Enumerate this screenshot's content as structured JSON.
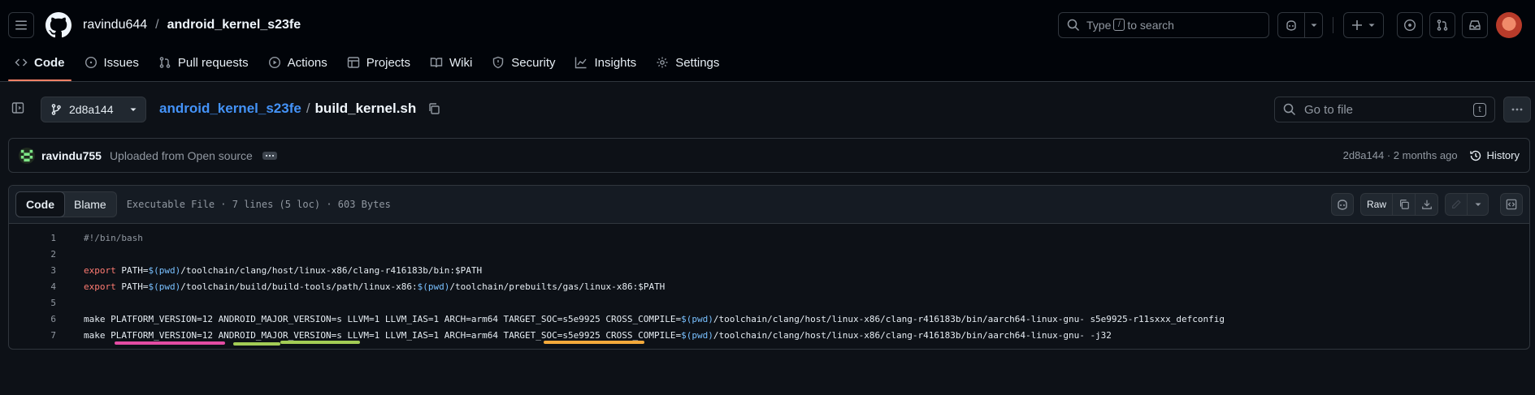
{
  "header": {
    "owner": "ravindu644",
    "separator": "/",
    "repo": "android_kernel_s23fe",
    "search": {
      "prefix": "Type",
      "key": "/",
      "suffix": "to search"
    }
  },
  "nav": {
    "tabs": [
      {
        "label": "Code",
        "icon": "code-icon",
        "active": true
      },
      {
        "label": "Issues",
        "icon": "issue-opened-icon"
      },
      {
        "label": "Pull requests",
        "icon": "git-pull-request-icon"
      },
      {
        "label": "Actions",
        "icon": "play-icon"
      },
      {
        "label": "Projects",
        "icon": "table-icon"
      },
      {
        "label": "Wiki",
        "icon": "book-icon"
      },
      {
        "label": "Security",
        "icon": "shield-icon"
      },
      {
        "label": "Insights",
        "icon": "graph-icon"
      },
      {
        "label": "Settings",
        "icon": "gear-icon"
      }
    ]
  },
  "filenav": {
    "branch": "2d8a144",
    "repo_link": "android_kernel_s23fe",
    "separator": "/",
    "filename": "build_kernel.sh",
    "goto_placeholder": "Go to file",
    "goto_key": "t"
  },
  "commit": {
    "author": "ravindu755",
    "message": "Uploaded from Open source",
    "meta": "2d8a144 · 2 months ago",
    "history_label": "History"
  },
  "codeview": {
    "tab_code": "Code",
    "tab_blame": "Blame",
    "info": "Executable File · 7 lines (5 loc) · 603 Bytes",
    "raw_label": "Raw",
    "lines": [
      {
        "n": "1",
        "parts": [
          {
            "t": "#!/bin/bash",
            "c": "cm"
          }
        ]
      },
      {
        "n": "2",
        "parts": []
      },
      {
        "n": "3",
        "parts": [
          {
            "t": "export",
            "c": "kw"
          },
          {
            "t": " PATH=",
            "c": ""
          },
          {
            "t": "$(pwd)",
            "c": "sub"
          },
          {
            "t": "/toolchain/clang/host/linux-x86/clang-r416183b/bin:$PATH",
            "c": ""
          }
        ]
      },
      {
        "n": "4",
        "parts": [
          {
            "t": "export",
            "c": "kw"
          },
          {
            "t": " PATH=",
            "c": ""
          },
          {
            "t": "$(pwd)",
            "c": "sub"
          },
          {
            "t": "/toolchain/build/build-tools/path/linux-x86:",
            "c": ""
          },
          {
            "t": "$(pwd)",
            "c": "sub"
          },
          {
            "t": "/toolchain/prebuilts/gas/linux-x86:$PATH",
            "c": ""
          }
        ]
      },
      {
        "n": "5",
        "parts": []
      },
      {
        "n": "6",
        "parts": [
          {
            "t": "make PLATFORM_VERSION=12 ANDROID_MAJOR_VERSION=s LLVM=1 LLVM_IAS=1 ARCH=arm64 TARGET_SOC=s5e9925 CROSS_COMPILE=",
            "c": ""
          },
          {
            "t": "$(pwd)",
            "c": "sub"
          },
          {
            "t": "/toolchain/clang/host/linux-x86/clang-r416183b/bin/aarch64-linux-gnu- s5e9925-r11sxxx_defconfig",
            "c": ""
          }
        ]
      },
      {
        "n": "7",
        "parts": [
          {
            "t": "make PLATFORM_VERSION=12 ANDROID_MAJOR_VERSION=s LLVM=1 LLVM_IAS=1 ARCH=arm64 TARGET_SOC=s5e9925 CROSS_COMPILE=",
            "c": ""
          },
          {
            "t": "$(pwd)",
            "c": "sub"
          },
          {
            "t": "/toolchain/clang/host/linux-x86/clang-r416183b/bin/aarch64-linux-gnu- -j32",
            "c": ""
          }
        ]
      }
    ]
  },
  "highlight_colors": {
    "pink": "#e34ca3",
    "green": "#a3cc55",
    "orange": "#f3a93b"
  }
}
